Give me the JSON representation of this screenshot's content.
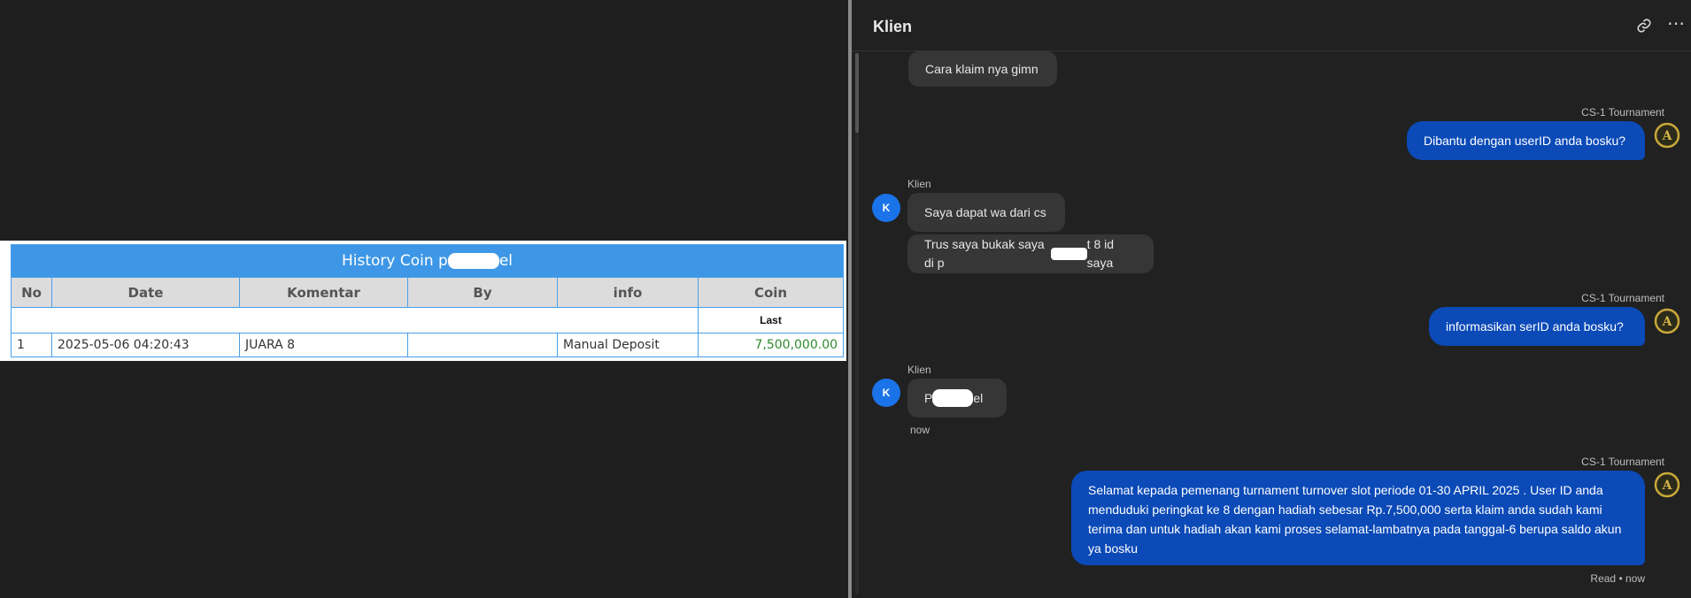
{
  "history": {
    "title_prefix": "History Coin p",
    "title_suffix": "el",
    "columns": [
      "No",
      "Date",
      "Komentar",
      "By",
      "info",
      "Coin"
    ],
    "sub_label": "Last",
    "rows": [
      {
        "no": "1",
        "date": "2025-05-06 04:20:43",
        "komentar": "JUARA 8",
        "by": "",
        "info": "Manual Deposit",
        "coin": "7,500,000.00"
      }
    ]
  },
  "chat": {
    "title": "Klien",
    "link_icon": "link-icon",
    "more_icon": "more-icon",
    "messages": [
      {
        "text": "Cara klaim nya gimn"
      },
      {
        "sender": "CS-1 Tournament",
        "text": "Dibantu dengan userID anda bosku?"
      },
      {
        "sender": "Klien",
        "avatar": "K",
        "text": "Saya dapat wa dari cs"
      },
      {
        "text_prefix": "Trus saya bukak saya di p",
        "text_suffix": "t 8 id saya"
      },
      {
        "sender": "CS-1 Tournament",
        "text": "informasikan serID anda bosku?"
      },
      {
        "sender": "Klien",
        "avatar": "K",
        "text_prefix": "P",
        "text_suffix": "el",
        "time": "now"
      },
      {
        "sender": "CS-1 Tournament",
        "text": "Selamat kepada pemenang turnament turnover slot periode 01-30 APRIL 2025 . User ID anda menduduki peringkat ke 8 dengan hadiah sebesar Rp.7,500,000 serta klaim anda sudah kami terima dan untuk hadiah akan kami proses selamat-lambatnya pada tanggal-6 berupa saldo akun ya bosku",
        "status": "Read • now"
      }
    ]
  },
  "colors": {
    "accent": "#0b4ab7",
    "table_header": "#3d97e6",
    "coin_green": "#2e8b2e"
  }
}
